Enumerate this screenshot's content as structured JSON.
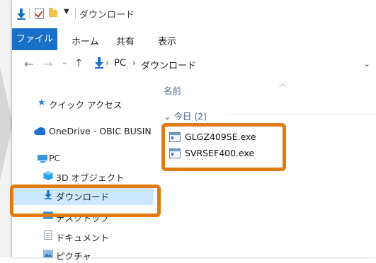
{
  "window": {
    "title": "ダウンロード"
  },
  "quick_access_toolbar": {
    "items": [
      "download-arrow-icon",
      "checklist-icon",
      "folder-icon",
      "customize-arrow-icon"
    ]
  },
  "ribbon": {
    "tabs": [
      {
        "label": "ファイル",
        "active": true
      },
      {
        "label": "ホーム"
      },
      {
        "label": "共有"
      },
      {
        "label": "表示"
      }
    ]
  },
  "address_bar": {
    "breadcrumbs": [
      "PC",
      "ダウンロード"
    ],
    "separator": "›"
  },
  "nav_pane": {
    "items": [
      {
        "label": "クイック アクセス",
        "icon": "star-icon"
      },
      {
        "label": "OneDrive - OBIC BUSIN",
        "icon": "cloud-icon"
      },
      {
        "label": "PC",
        "icon": "computer-icon"
      },
      {
        "label": "3D オブジェクト",
        "icon": "cube-icon"
      },
      {
        "label": "ダウンロード",
        "icon": "download-arrow-icon",
        "selected": true
      },
      {
        "label": "デスクトップ",
        "icon": "desktop-icon"
      },
      {
        "label": "ドキュメント",
        "icon": "document-icon"
      },
      {
        "label": "ピクチャ",
        "icon": "picture-icon"
      }
    ]
  },
  "content": {
    "column_header": "名前",
    "group": {
      "label": "今日 (2)"
    },
    "files": [
      {
        "name": "GLGZ409SE.exe"
      },
      {
        "name": "SVRSEF400.exe"
      }
    ]
  },
  "colors": {
    "accent": "#1a6fc7",
    "highlight": "#e07a12",
    "selection": "#cce8ff"
  }
}
